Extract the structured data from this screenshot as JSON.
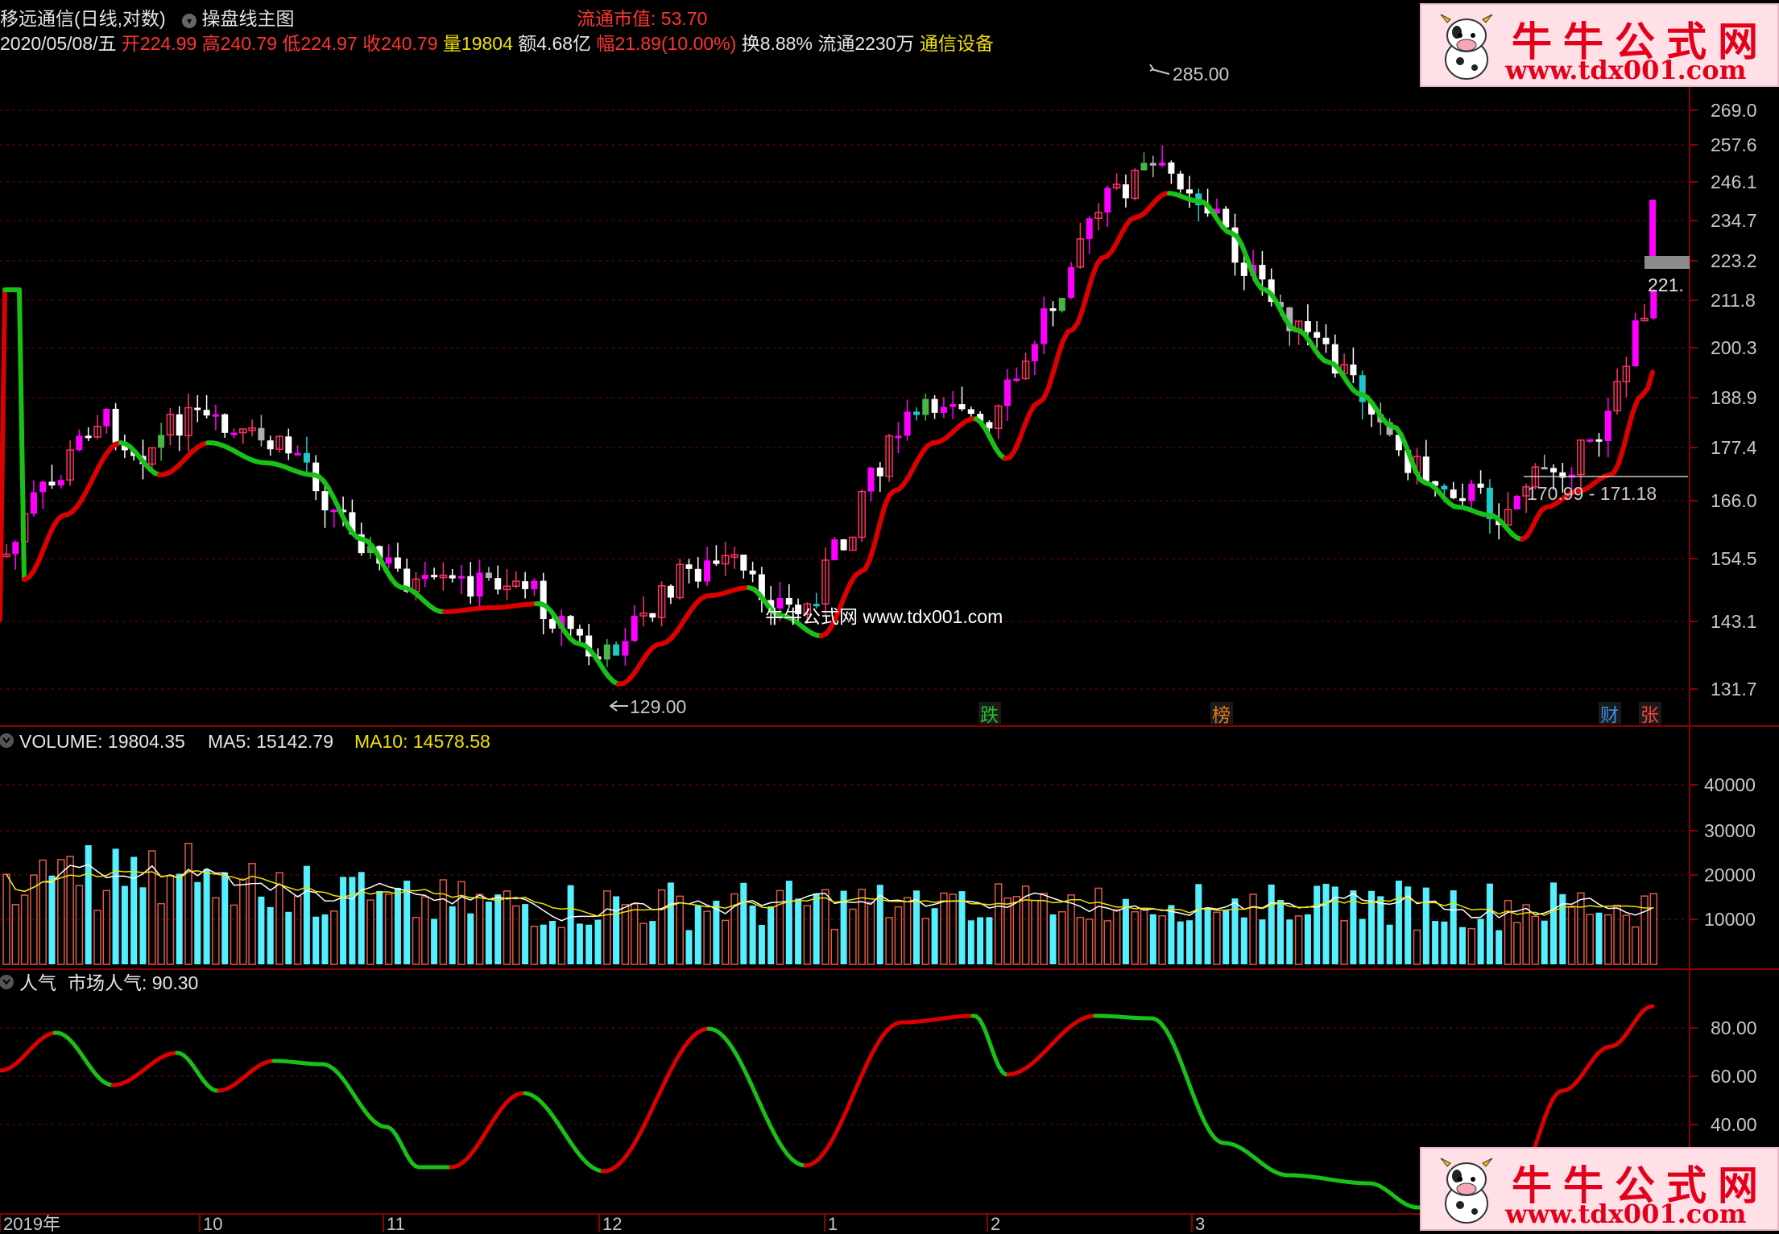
{
  "header": {
    "stock_name": "移远通信",
    "period_mode": "(日线,对数)",
    "template_label": "操盘线主图",
    "circ_market_cap": "流通市值: 53.70",
    "date": "2020/05/08/五",
    "open": "开224.99",
    "high": "高240.79",
    "low": "低224.97",
    "close": "收240.79",
    "volume": "量19804",
    "amount": "额4.68亿",
    "change": "幅21.89(10.00%)",
    "turnover": "换8.88%",
    "float_shares": "流通2230万",
    "sector": "通信设备"
  },
  "main_panel": {
    "price_axis": [
      "269.0",
      "257.6",
      "246.1",
      "234.7",
      "223.2",
      "211.8",
      "200.3",
      "188.9",
      "177.4",
      "166.0",
      "154.5",
      "143.1",
      "131.7"
    ],
    "price_marks": {
      "high": "285.00",
      "low": "129.00",
      "current": "221.",
      "range": "170.99 - 171.18"
    },
    "center_watermark": "牛牛公式网 www.tdx001.com",
    "event_tags": [
      {
        "text": "跌",
        "color": "#25c02a"
      },
      {
        "text": "榜",
        "color": "#e07a1f"
      },
      {
        "text": "财",
        "color": "#3a8ee6"
      },
      {
        "text": "张",
        "color": "#ff4040"
      }
    ]
  },
  "volume_panel": {
    "label": "VOLUME: 19804.35",
    "ma5": "MA5: 15142.79",
    "ma10": "MA10: 14578.58",
    "axis": [
      "40000",
      "30000",
      "20000",
      "10000"
    ]
  },
  "indicator_panel": {
    "name": "人气",
    "label": "市场人气: 90.30",
    "axis": [
      "80.00",
      "60.00",
      "40.00"
    ]
  },
  "time_axis": [
    "2019年",
    "10",
    "11",
    "12",
    "1",
    "2",
    "3"
  ],
  "watermark": {
    "title": "牛牛公式网",
    "url": "www.tdx001.com"
  },
  "colors": {
    "up": "#ff3366",
    "down": "#ffffff",
    "ma_rise": "#dd0000",
    "ma_fall": "#18c018",
    "vol_up": "#e05a44",
    "vol_down": "#55f0ff",
    "magenta": "#ff00ff",
    "grid": "#8b0000"
  },
  "icons": [
    "dropdown-circle-icon",
    "cow-logo-icon"
  ]
}
